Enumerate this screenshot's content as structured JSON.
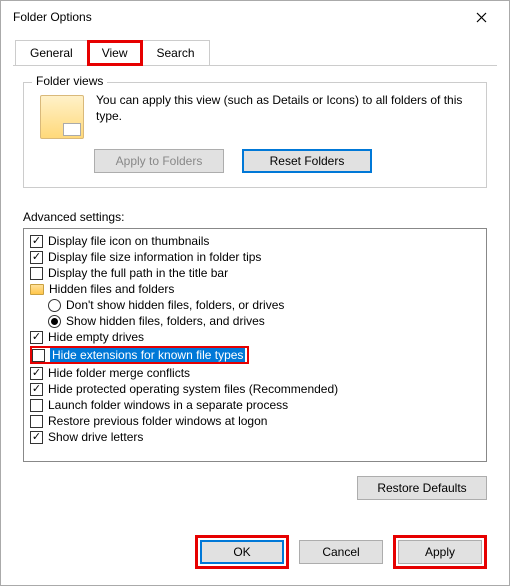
{
  "window": {
    "title": "Folder Options"
  },
  "tabs": {
    "general": "General",
    "view": "View",
    "search": "Search"
  },
  "folderViews": {
    "legend": "Folder views",
    "desc": "You can apply this view (such as Details or Icons) to all folders of this type.",
    "applyBtn": "Apply to Folders",
    "resetBtn": "Reset Folders"
  },
  "advanced": {
    "label": "Advanced settings:",
    "items": [
      {
        "kind": "check",
        "checked": true,
        "label": "Display file icon on thumbnails",
        "indent": 0
      },
      {
        "kind": "check",
        "checked": true,
        "label": "Display file size information in folder tips",
        "indent": 0
      },
      {
        "kind": "check",
        "checked": false,
        "label": "Display the full path in the title bar",
        "indent": 0
      },
      {
        "kind": "folder",
        "label": "Hidden files and folders",
        "indent": 0
      },
      {
        "kind": "radio",
        "selected": false,
        "label": "Don't show hidden files, folders, or drives",
        "indent": 1
      },
      {
        "kind": "radio",
        "selected": true,
        "label": "Show hidden files, folders, and drives",
        "indent": 1
      },
      {
        "kind": "check",
        "checked": true,
        "label": "Hide empty drives",
        "indent": 0
      },
      {
        "kind": "check",
        "checked": false,
        "label": "Hide extensions for known file types",
        "indent": 0,
        "highlight": true
      },
      {
        "kind": "check",
        "checked": true,
        "label": "Hide folder merge conflicts",
        "indent": 0
      },
      {
        "kind": "check",
        "checked": true,
        "label": "Hide protected operating system files (Recommended)",
        "indent": 0
      },
      {
        "kind": "check",
        "checked": false,
        "label": "Launch folder windows in a separate process",
        "indent": 0
      },
      {
        "kind": "check",
        "checked": false,
        "label": "Restore previous folder windows at logon",
        "indent": 0
      },
      {
        "kind": "check",
        "checked": true,
        "label": "Show drive letters",
        "indent": 0
      }
    ]
  },
  "buttons": {
    "restoreDefaults": "Restore Defaults",
    "ok": "OK",
    "cancel": "Cancel",
    "apply": "Apply"
  }
}
